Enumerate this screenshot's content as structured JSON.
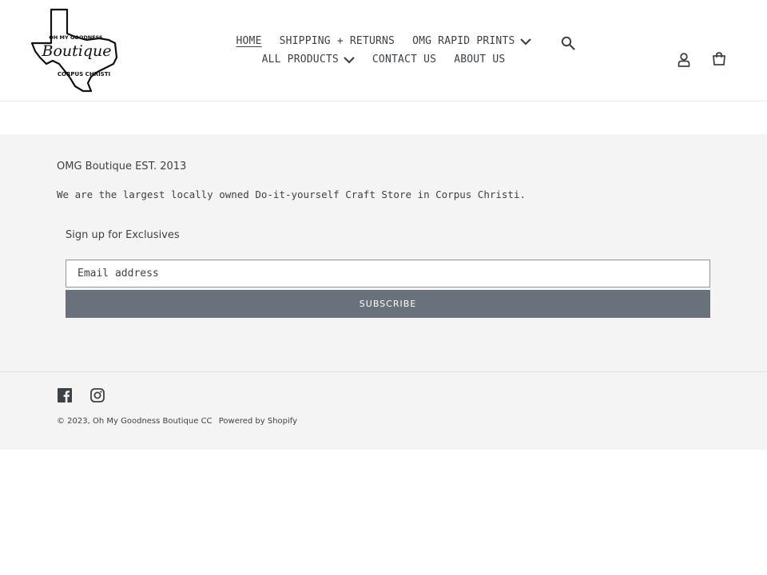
{
  "header": {
    "logo": {
      "line1": "OH MY GOODNESS",
      "line2": "Boutique",
      "line3": "CORPUS CHRISTI"
    },
    "nav": {
      "row1": [
        {
          "label": "HOME",
          "active": true,
          "dropdown": false
        },
        {
          "label": "SHIPPING + RETURNS",
          "active": false,
          "dropdown": false
        },
        {
          "label": "OMG RAPID PRINTS",
          "active": false,
          "dropdown": true
        }
      ],
      "row2": [
        {
          "label": "ALL PRODUCTS",
          "active": false,
          "dropdown": true
        },
        {
          "label": "CONTACT US",
          "active": false,
          "dropdown": false
        },
        {
          "label": "ABOUT US",
          "active": false,
          "dropdown": false
        }
      ]
    },
    "icons": {
      "search": "search-icon",
      "account": "user-icon",
      "cart": "cart-icon"
    }
  },
  "footer": {
    "title": "OMG Boutique EST. 2013",
    "description": "We are the largest locally owned Do-it-yourself Craft Store in Corpus Christi.",
    "newsletter": {
      "heading": "Sign up for Exclusives",
      "placeholder": "Email address",
      "button_label": "SUBSCRIBE"
    },
    "social": [
      "facebook-icon",
      "instagram-icon"
    ],
    "copyright_prefix": "© 2023,",
    "store_name": "Oh My Goodness Boutique CC",
    "powered_by": "Powered by Shopify"
  },
  "colors": {
    "text": "#3d4246",
    "footer_bg": "#f4f4f4",
    "button_bg": "#69727b"
  }
}
